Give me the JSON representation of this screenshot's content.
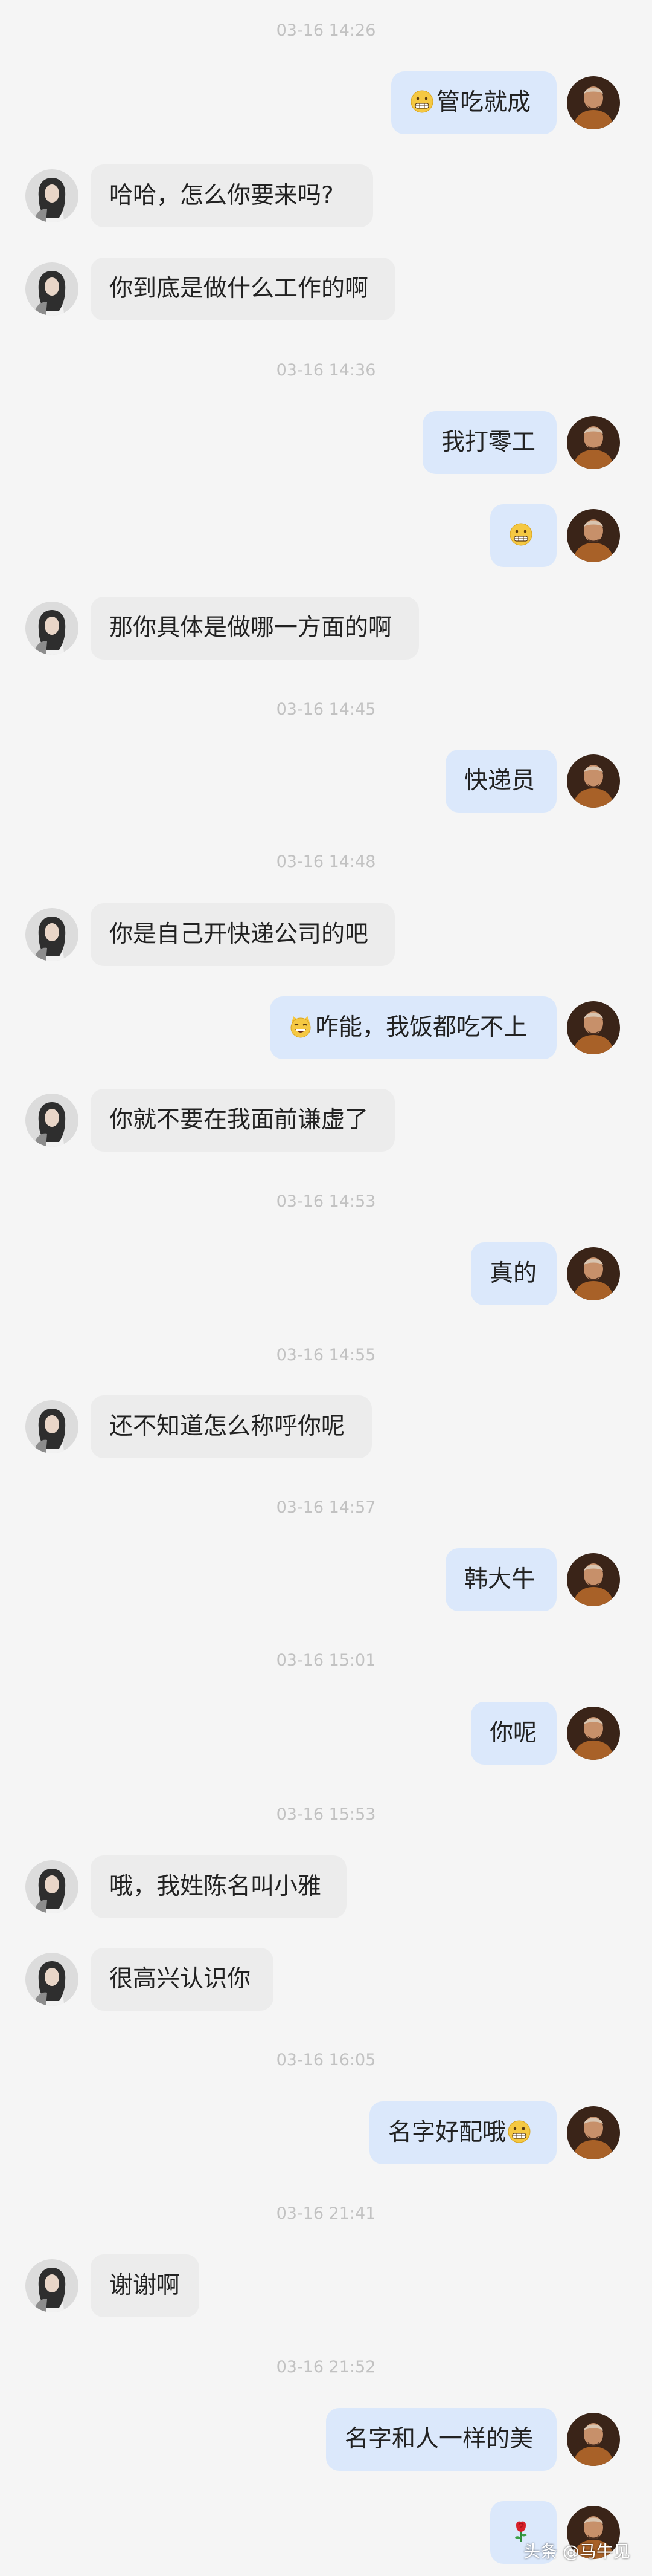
{
  "colors": {
    "background": "#f5f5f5",
    "incoming_bubble": "#ececec",
    "outgoing_bubble": "#dbe8fb",
    "timestamp": "#c2c2c2"
  },
  "conversation": [
    {
      "type": "time",
      "text": "03-16 14:26"
    },
    {
      "type": "msg",
      "side": "right",
      "emoji": "grimacing-face",
      "text": "管吃就成"
    },
    {
      "type": "msg",
      "side": "left",
      "text": "哈哈，怎么你要来吗?"
    },
    {
      "type": "msg",
      "side": "left",
      "text": "你到底是做什么工作的啊"
    },
    {
      "type": "time",
      "text": "03-16 14:36"
    },
    {
      "type": "msg",
      "side": "right",
      "text": "我打零工"
    },
    {
      "type": "msg",
      "side": "right",
      "emoji": "grimacing-face",
      "text": ""
    },
    {
      "type": "msg",
      "side": "left",
      "text": "那你具体是做哪一方面的啊"
    },
    {
      "type": "time",
      "text": "03-16 14:45"
    },
    {
      "type": "msg",
      "side": "right",
      "text": "快递员"
    },
    {
      "type": "time",
      "text": "03-16 14:48"
    },
    {
      "type": "msg",
      "side": "left",
      "text": "你是自己开快递公司的吧"
    },
    {
      "type": "msg",
      "side": "right",
      "emoji": "grinning-cat",
      "text": "咋能，我饭都吃不上"
    },
    {
      "type": "msg",
      "side": "left",
      "text": "你就不要在我面前谦虚了"
    },
    {
      "type": "time",
      "text": "03-16 14:53"
    },
    {
      "type": "msg",
      "side": "right",
      "text": "真的"
    },
    {
      "type": "time",
      "text": "03-16 14:55"
    },
    {
      "type": "msg",
      "side": "left",
      "text": "还不知道怎么称呼你呢"
    },
    {
      "type": "time",
      "text": "03-16 14:57"
    },
    {
      "type": "msg",
      "side": "right",
      "text": "韩大牛"
    },
    {
      "type": "time",
      "text": "03-16 15:01"
    },
    {
      "type": "msg",
      "side": "right",
      "text": "你呢"
    },
    {
      "type": "time",
      "text": "03-16 15:53"
    },
    {
      "type": "msg",
      "side": "left",
      "text": "哦，我姓陈名叫小雅"
    },
    {
      "type": "msg",
      "side": "left",
      "text": "很高兴认识你"
    },
    {
      "type": "time",
      "text": "03-16 16:05"
    },
    {
      "type": "msg",
      "side": "right",
      "text": "名字好配哦",
      "emoji_after": "grimacing-face"
    },
    {
      "type": "time",
      "text": "03-16 21:41"
    },
    {
      "type": "msg",
      "side": "left",
      "text": "谢谢啊"
    },
    {
      "type": "time",
      "text": "03-16 21:52"
    },
    {
      "type": "msg",
      "side": "right",
      "text": "名字和人一样的美"
    },
    {
      "type": "msg",
      "side": "right",
      "emoji": "rose",
      "text": ""
    }
  ],
  "watermark": "头条 @马牛见"
}
